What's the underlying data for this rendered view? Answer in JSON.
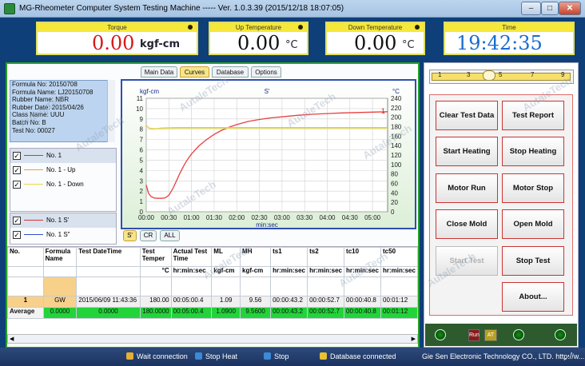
{
  "window": {
    "title": "MG-Rheometer Computer System Testing Machine ----- Ver. 1.0.3.39 (2015/12/18 18:07:05)",
    "min": "–",
    "max": "□",
    "close": "✕"
  },
  "meters": {
    "torque": {
      "label": "Torque",
      "value": "0.00",
      "unit": "kgf-cm"
    },
    "up_temp": {
      "label": "Up Temperature",
      "value": "0.00",
      "unit": "°C"
    },
    "down_temp": {
      "label": "Down Temperature",
      "value": "0.00",
      "unit": "°C"
    },
    "time": {
      "label": "Time",
      "value": "19:42:35"
    }
  },
  "tabs": [
    "Main Data",
    "Curves",
    "Database",
    "Options"
  ],
  "info": [
    "Formula No: 20150708",
    "Formula Name: LJ20150708",
    "Rubber Name: NBR",
    "Rubber Date: 2015/04/26",
    "Class Name: UUU",
    "Batch No: B",
    "Test No: 00027"
  ],
  "legend_top": [
    {
      "label": "No. 1",
      "color": "#e03030"
    },
    {
      "label": "No. 1 - Up",
      "color": "#f0a040"
    },
    {
      "label": "No. 1 - Down",
      "color": "#e8d84a"
    }
  ],
  "legend_bottom": [
    {
      "label": "No. 1 S'",
      "color": "#e03030"
    },
    {
      "label": "No. 1 S\"",
      "color": "#3050c8"
    }
  ],
  "chart_tabs": [
    "S'",
    "CR",
    "ALL"
  ],
  "chart_data": {
    "type": "line",
    "title": "S'",
    "ylabel": "kgf-cm",
    "y2label": "°C",
    "xlabel": "min:sec",
    "ylim": [
      0,
      11
    ],
    "y2lim": [
      0,
      240
    ],
    "yticks": [
      "0",
      "1",
      "2",
      "3",
      "4",
      "5",
      "6",
      "7",
      "8",
      "9",
      "10",
      "11"
    ],
    "y2ticks": [
      "0",
      "20",
      "40",
      "60",
      "80",
      "100",
      "120",
      "140",
      "160",
      "180",
      "200",
      "220",
      "240"
    ],
    "x_ticks": [
      "00:00",
      "00:30",
      "01:00",
      "01:30",
      "02:00",
      "02:30",
      "03:00",
      "03:30",
      "04:00",
      "04:30",
      "05:00"
    ],
    "series": [
      {
        "name": "1",
        "color": "#e84040",
        "axis": "left",
        "x": [
          0,
          3,
          6,
          10,
          15,
          20,
          25,
          30,
          35,
          40,
          45,
          50,
          55,
          60,
          70,
          80,
          90,
          100,
          110,
          120,
          135,
          150,
          165,
          180,
          200,
          220,
          240,
          260,
          280,
          300,
          320
        ],
        "y": [
          2.6,
          1.8,
          1.5,
          1.35,
          1.3,
          1.3,
          1.35,
          1.6,
          2.2,
          3.0,
          3.8,
          4.5,
          5.1,
          5.6,
          6.4,
          7.0,
          7.5,
          7.9,
          8.2,
          8.45,
          8.75,
          8.95,
          9.1,
          9.2,
          9.35,
          9.45,
          9.52,
          9.58,
          9.62,
          9.66,
          9.7
        ]
      },
      {
        "name": "Up",
        "color": "#f0b040",
        "axis": "right",
        "x": [
          0,
          5,
          10,
          20,
          40,
          60,
          100,
          150,
          200,
          250,
          300,
          320
        ],
        "y": [
          182,
          176,
          175,
          177,
          178,
          178,
          178,
          178,
          178,
          178,
          178,
          178
        ]
      },
      {
        "name": "Down",
        "color": "#e8e060",
        "axis": "right",
        "x": [
          0,
          5,
          10,
          20,
          40,
          60,
          100,
          150,
          200,
          250,
          300,
          320
        ],
        "y": [
          180,
          177,
          176,
          176,
          177,
          177,
          177,
          177,
          177,
          177,
          177,
          177
        ]
      }
    ]
  },
  "table": {
    "headers": [
      "No.",
      "Formula Name",
      "Test DateTime",
      "Test Temper",
      "Actual Test Time",
      "ML",
      "MH",
      "ts1",
      "ts2",
      "tc10",
      "tc50"
    ],
    "units": [
      "",
      "",
      "",
      "°C",
      "hr:min:sec",
      "kgf-cm",
      "kgf-cm",
      "hr:min:sec",
      "hr:min:sec",
      "hr:min:sec",
      "hr:min:sec"
    ],
    "row1": [
      "1",
      "GW",
      "2015/06/09 11:43:36",
      "180.00",
      "00:05:00.4",
      "1.09",
      "9.56",
      "00:00:43.2",
      "00:00:52.7",
      "00:00:40.8",
      "00:01:12"
    ],
    "avg": [
      "Average",
      "0.0000",
      "0.0000",
      "180.0000",
      "00:05:00.4",
      "1.0900",
      "9.5600",
      "00:00:43.2",
      "00:00:52.7",
      "00:00:40.8",
      "00:01:12"
    ]
  },
  "slider": {
    "ticks": [
      "1",
      "3",
      "5",
      "7",
      "9"
    ],
    "value": 4
  },
  "controls": [
    "Clear Test Data",
    "Test Report",
    "Start Heating",
    "Stop Heating",
    "Motor Run",
    "Motor Stop",
    "Close Mold",
    "Open Mold",
    "Start Test",
    "Stop Test",
    "About..."
  ],
  "indicators": {
    "run": "Run",
    "at": "AT"
  },
  "status": {
    "wait": "Wait connection",
    "heat": "Stop Heat",
    "stop": "Stop",
    "db": "Database connected",
    "company": "Gie Sen Electronic Technology CO., LTD.  http://w..."
  },
  "watermark": "AutaleTech"
}
